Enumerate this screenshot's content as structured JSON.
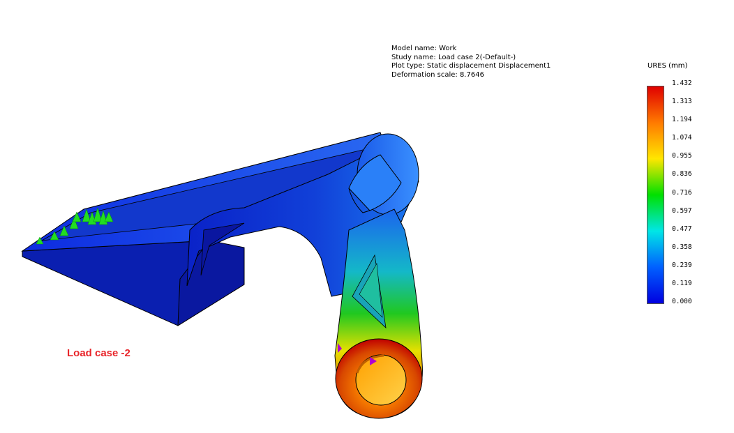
{
  "study_info": {
    "model_name": "Model name: Work",
    "study_name": "Study name: Load case 2(-Default-)",
    "plot_type": "Plot type: Static displacement Displacement1",
    "deformation_scale": "Deformation scale: 8.7646"
  },
  "legend": {
    "title": "URES (mm)",
    "ticks": [
      "1.432",
      "1.313",
      "1.194",
      "1.074",
      "0.955",
      "0.836",
      "0.716",
      "0.597",
      "0.477",
      "0.358",
      "0.239",
      "0.119",
      "0.000"
    ],
    "colors": [
      "#e00000",
      "#ff7a00",
      "#ffe600",
      "#00e000",
      "#00e6e6",
      "#0060ff",
      "#0000e0"
    ]
  },
  "case_label": "Load case -2",
  "colors": {
    "case_label": "#e8252a",
    "fixture_marker": "#22dd22",
    "load_marker": "#b000d0"
  }
}
